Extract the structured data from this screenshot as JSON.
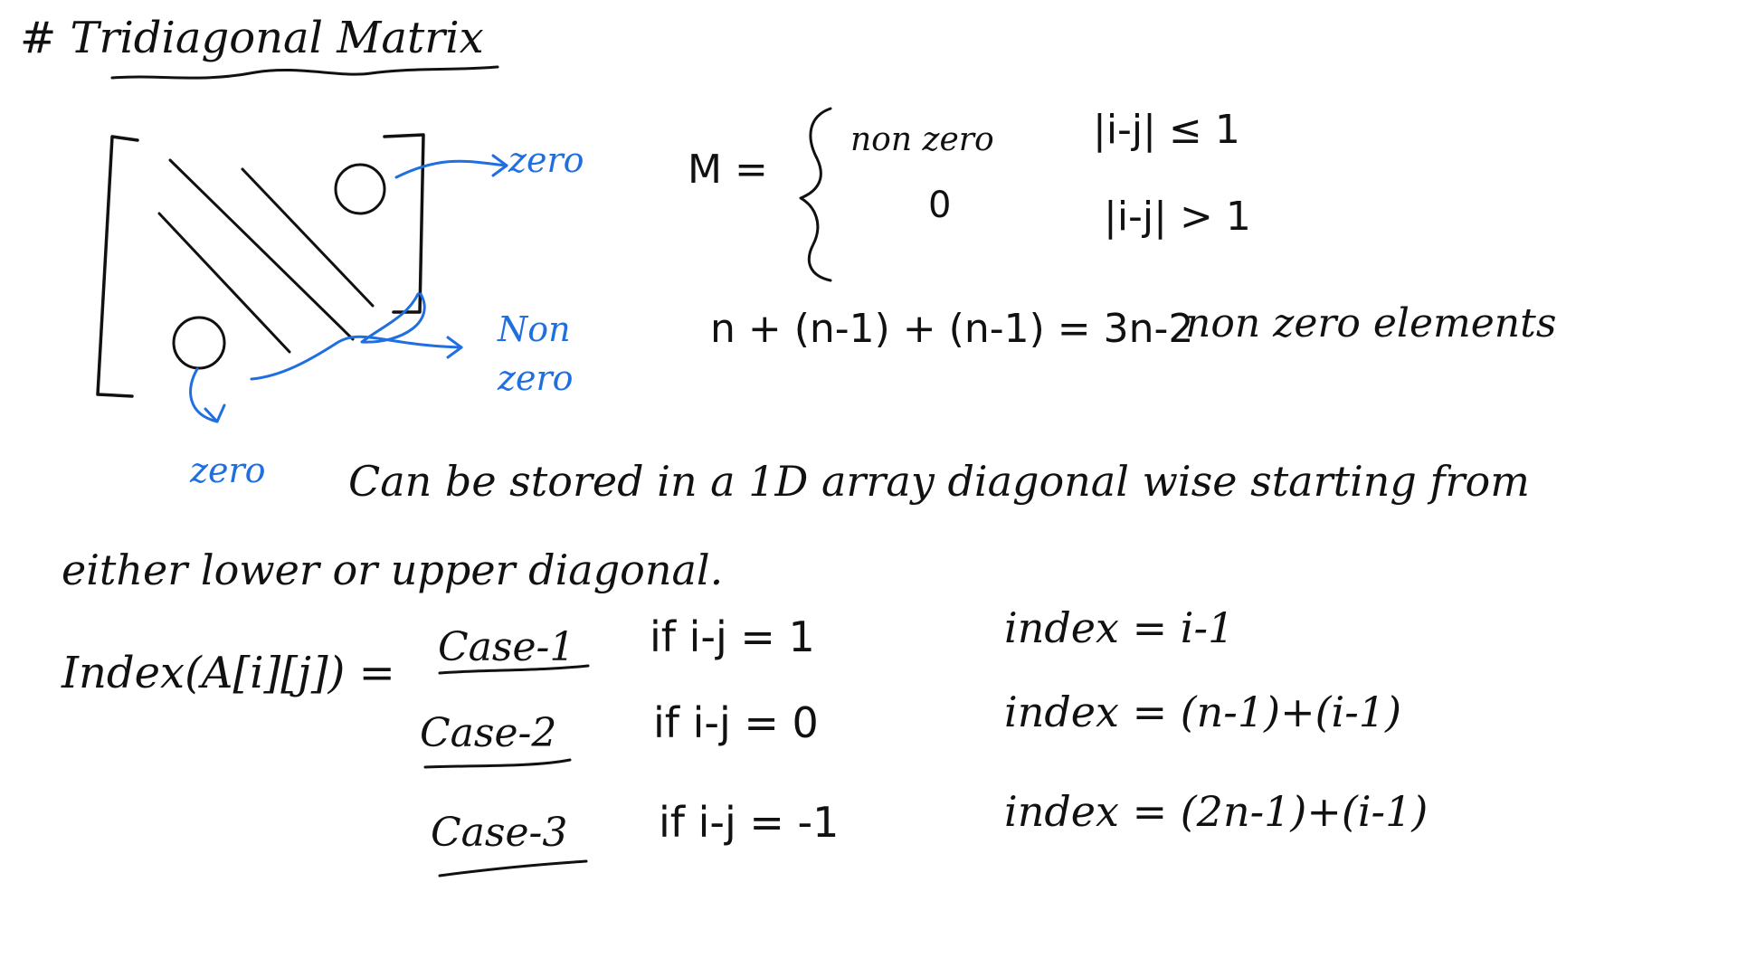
{
  "title": "# Tridiagonal Matrix",
  "diagram": {
    "labels": {
      "zero_top": "zero",
      "nonzero_line_1": "Non",
      "nonzero_line_2": "zero",
      "zero_bottom": "zero"
    },
    "zero_marks": [
      "0",
      "0"
    ]
  },
  "definition": {
    "lhs": "M =",
    "cases": [
      {
        "value": "non zero",
        "condition": "|i-j| ≤ 1"
      },
      {
        "value": "0",
        "condition": "|i-j| > 1"
      }
    ]
  },
  "count": {
    "expression": "n + (n-1) + (n-1) = 3n-2",
    "description": "non zero elements"
  },
  "storage_note": {
    "line1": "Can be stored in a 1D array diagonal wise starting from",
    "line2": "either lower or upper diagonal."
  },
  "index_formula": {
    "lhs": "Index(A[i][j]) =",
    "cases": [
      {
        "label": "Case-1",
        "condition": "if i-j = 1",
        "result": "index = i-1"
      },
      {
        "label": "Case-2",
        "condition": "if i-j = 0",
        "result": "index = (n-1)+(i-1)"
      },
      {
        "label": "Case-3",
        "condition": "if i-j = -1",
        "result": "index = (2n-1)+(i-1)"
      }
    ]
  },
  "colors": {
    "ink": "#111111",
    "annotation": "#1f6fe0",
    "background": "#ffffff"
  }
}
